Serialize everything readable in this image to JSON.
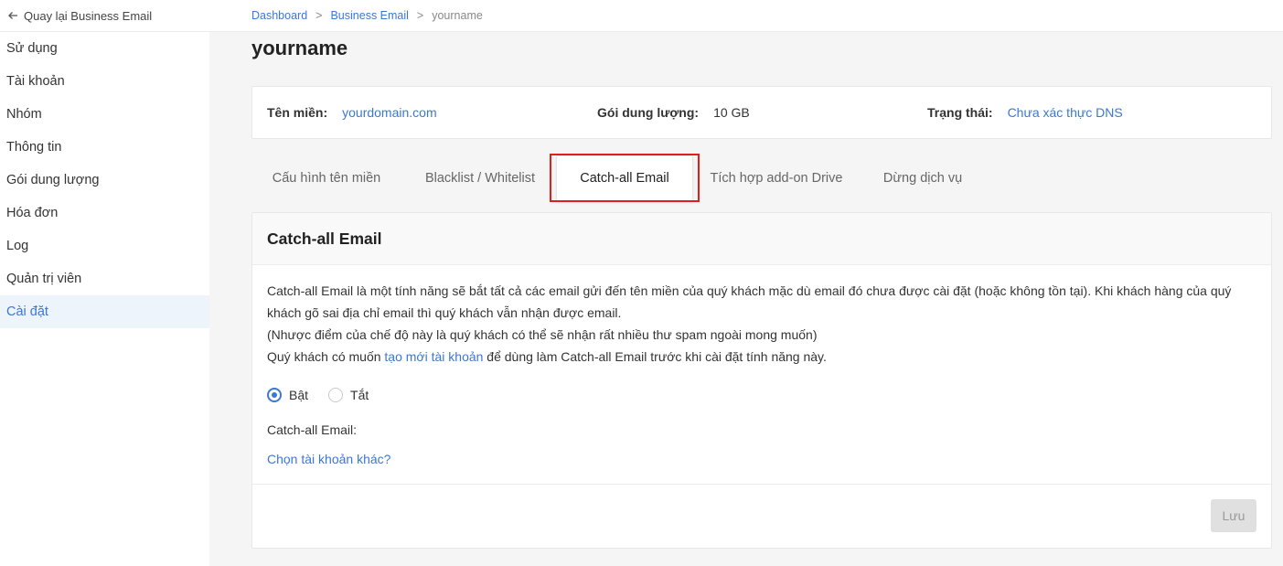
{
  "sidebar": {
    "back_label": "Quay lại Business Email",
    "items": [
      {
        "label": "Sử dụng"
      },
      {
        "label": "Tài khoản"
      },
      {
        "label": "Nhóm"
      },
      {
        "label": "Thông tin"
      },
      {
        "label": "Gói dung lượng"
      },
      {
        "label": "Hóa đơn"
      },
      {
        "label": "Log"
      },
      {
        "label": "Quản trị viên"
      },
      {
        "label": "Cài đặt",
        "active": true
      }
    ]
  },
  "breadcrumb": {
    "items": [
      "Dashboard",
      "Business Email"
    ],
    "separator": ">",
    "current": "yourname"
  },
  "page_title": "yourname",
  "info": {
    "domain_label": "Tên miền:",
    "domain_value": "yourdomain.com",
    "plan_label": "Gói dung lượng:",
    "plan_value": "10 GB",
    "status_label": "Trạng thái:",
    "status_value": "Chưa xác thực DNS"
  },
  "tabs": [
    {
      "label": "Cấu hình tên miền"
    },
    {
      "label": "Blacklist / Whitelist"
    },
    {
      "label": "Catch-all Email",
      "active": true
    },
    {
      "label": "Tích hợp add-on Drive"
    },
    {
      "label": "Dừng dịch vụ"
    }
  ],
  "section": {
    "title": "Catch-all Email",
    "desc_line1": "Catch-all Email là một tính năng sẽ bắt tất cả các email gửi đến tên miền của quý khách mặc dù email đó chưa được cài đặt (hoặc không tồn tại). Khi khách hàng của quý khách gõ sai địa chỉ email thì quý khách vẫn nhận được email.",
    "desc_line2": "(Nhược điểm của chế độ này là quý khách có thể sẽ nhận rất nhiều thư spam ngoài mong muốn)",
    "desc_line3_pre": "Quý khách có muốn ",
    "desc_line3_link": "tạo mới tài khoản",
    "desc_line3_post": " để dùng làm Catch-all Email trước khi cài đặt tính năng này.",
    "radio_on": "Bật",
    "radio_off": "Tắt",
    "selected": "on",
    "field_label": "Catch-all Email:",
    "choose_link": "Chọn tài khoản khác?",
    "save_label": "Lưu"
  },
  "colors": {
    "accent": "#3a78d6",
    "highlight": "#e01e1e"
  }
}
